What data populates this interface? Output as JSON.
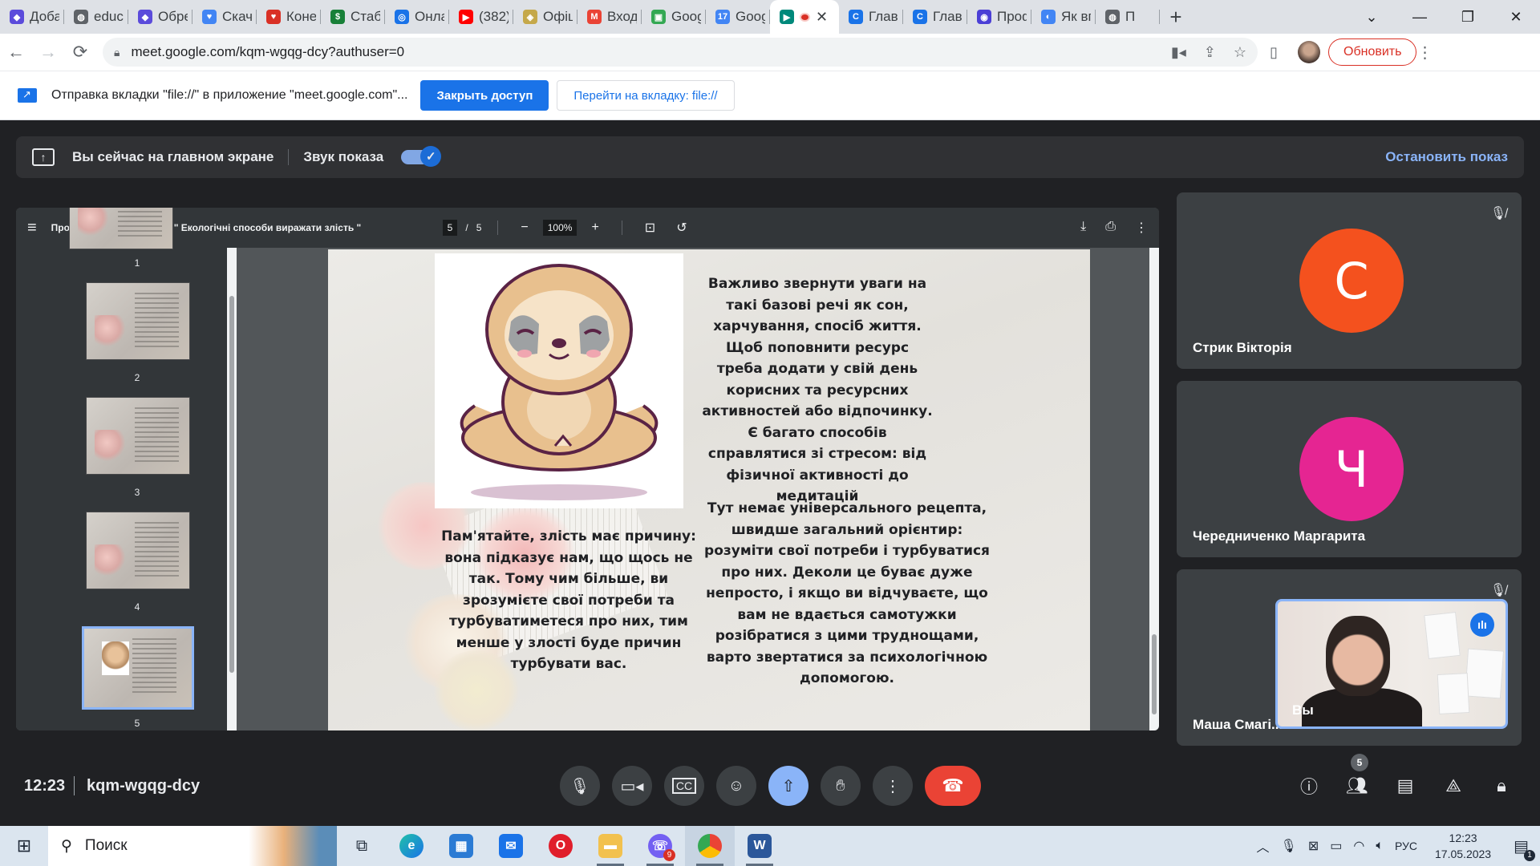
{
  "browser": {
    "tabs": [
      {
        "title": "Доба",
        "color": "#5b4bdb",
        "icon": "shield-icon"
      },
      {
        "title": "educ",
        "color": "#5f6368",
        "icon": "globe-icon"
      },
      {
        "title": "Обре",
        "color": "#5b4bdb",
        "icon": "shield-icon"
      },
      {
        "title": "Скача",
        "color": "#4285f4",
        "icon": "heart-icon"
      },
      {
        "title": "Коне",
        "color": "#d93025",
        "icon": "heart-icon"
      },
      {
        "title": "Стабі",
        "color": "#188038",
        "icon": "spreadsheet-icon"
      },
      {
        "title": "Онла",
        "color": "#1a73e8",
        "icon": "circle-icon"
      },
      {
        "title": "(382)",
        "color": "#ff0000",
        "icon": "youtube-icon"
      },
      {
        "title": "Офіц",
        "color": "#c5a84a",
        "icon": "emblem-icon"
      },
      {
        "title": "Входя",
        "color": "#ea4335",
        "icon": "gmail-icon"
      },
      {
        "title": "Goog",
        "color": "#34a853",
        "icon": "classroom-icon"
      },
      {
        "title": "Goog",
        "color": "#4285f4",
        "icon": "calendar-icon"
      },
      {
        "title": "",
        "color": "#00897b",
        "icon": "meet-icon",
        "active": true
      },
      {
        "title": "Главн",
        "color": "#1a73e8",
        "icon": "c-icon"
      },
      {
        "title": "Главн",
        "color": "#1a73e8",
        "icon": "c-icon"
      },
      {
        "title": "Проф",
        "color": "#4b3fd6",
        "icon": "chat-icon"
      },
      {
        "title": "Як вп",
        "color": "#4285f4",
        "icon": "edge-icon"
      },
      {
        "title": "П",
        "color": "#5f6368",
        "icon": "globe-icon"
      }
    ],
    "url": "meet.google.com/kqm-wgqg-dcy?authuser=0",
    "update_label": "Обновить"
  },
  "infobar": {
    "text": "Отправка вкладки \"file://\" в приложение \"meet.google.com\"...",
    "close_access": "Закрыть доступ",
    "goto_tab": "Перейти на вкладку: file://"
  },
  "present_bar": {
    "text": "Вы сейчас на главном экране",
    "sound": "Звук показа",
    "stop": "Остановить показ"
  },
  "pdf": {
    "title": "Профілактичний тренінг: \" Екологічні способи виражати злість \"",
    "page": "5",
    "sep": "/",
    "total": "5",
    "zoom": "100%",
    "thumb_numbers": [
      "1",
      "2",
      "3",
      "4",
      "5"
    ],
    "slide_text_1": "Важливо звернути уваги на такі базові речі як сон, харчування, спосіб життя. Щоб поповнити ресурс треба додати у свій день корисних та ресурсних активностей або відпочинку. Є багато способів справлятися зі стресом: від фізичної активності до медитацій",
    "slide_text_2": "Тут немає універсального рецепта, швидше загальний орієнтир: розуміти свої потреби і турбуватися про них. Деколи це буває дуже непросто, і якщо ви відчуваєте, що вам не вдається самотужки розібратися з цими труднощами, варто звертатися за психологічною допомогою.",
    "slide_text_3": "Пам'ятайте, злість має причину: вона підказує нам, що щось не так. Тому чим більше, ви зрозумієте свої потреби та турбуватиметеся про них, тим менше у злості буде причин турбувати вас."
  },
  "participants": [
    {
      "initial": "С",
      "name": "Стрик Вікторія",
      "color": "#f4511e"
    },
    {
      "initial": "Ч",
      "name": "Чередниченко Маргарита",
      "color": "#e52592"
    },
    {
      "initial": "",
      "name": "Маша Смагі...",
      "color": "#3c4043"
    }
  ],
  "self_view": {
    "label": "Вы"
  },
  "meet_bar": {
    "time": "12:23",
    "code": "kqm-wgqg-dcy",
    "people_count": "5"
  },
  "taskbar": {
    "search": "Поиск",
    "lang": "РУС",
    "time": "12:23",
    "date": "17.05.2023",
    "notifications": "1",
    "viber_badge": "9"
  }
}
